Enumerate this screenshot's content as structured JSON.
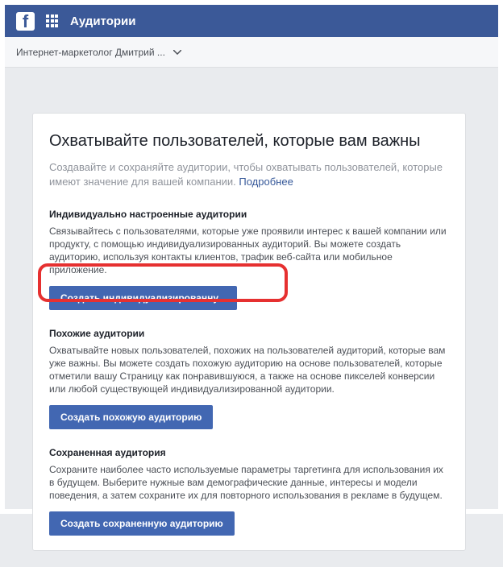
{
  "topbar": {
    "title": "Аудитории"
  },
  "subbar": {
    "account": "Интернет-маркетолог Дмитрий ..."
  },
  "main": {
    "title": "Охватывайте пользователей, которые вам важны",
    "desc_prefix": "Создавайте и сохраняйте аудитории, чтобы охватывать пользователей, которые имеют значение для вашей компании. ",
    "learn_more": "Подробнее"
  },
  "sections": [
    {
      "title": "Индивидуально настроенные аудитории",
      "desc": "Связывайтесь с пользователями, которые уже проявили интерес к вашей компании или продукту, с помощью индивидуализированных аудиторий. Вы можете создать аудиторию, используя контакты клиентов, трафик веб-сайта или мобильное приложение.",
      "button": "Создать индивидуализированну..."
    },
    {
      "title": "Похожие аудитории",
      "desc": "Охватывайте новых пользователей, похожих на пользователей аудиторий, которые вам уже важны. Вы можете создать похожую аудиторию на основе пользователей, которые отметили вашу Страницу как понравившуюся, а также на основе пикселей конверсии или любой существующей индивидуализированной аудитории.",
      "button": "Создать похожую аудиторию"
    },
    {
      "title": "Сохраненная аудитория",
      "desc": "Сохраните наиболее часто используемые параметры таргетинга для использования их в будущем. Выберите нужные вам демографические данные, интересы и модели поведения, а затем сохраните их для повторного использования в рекламе в будущем.",
      "button": "Создать сохраненную аудиторию"
    }
  ]
}
